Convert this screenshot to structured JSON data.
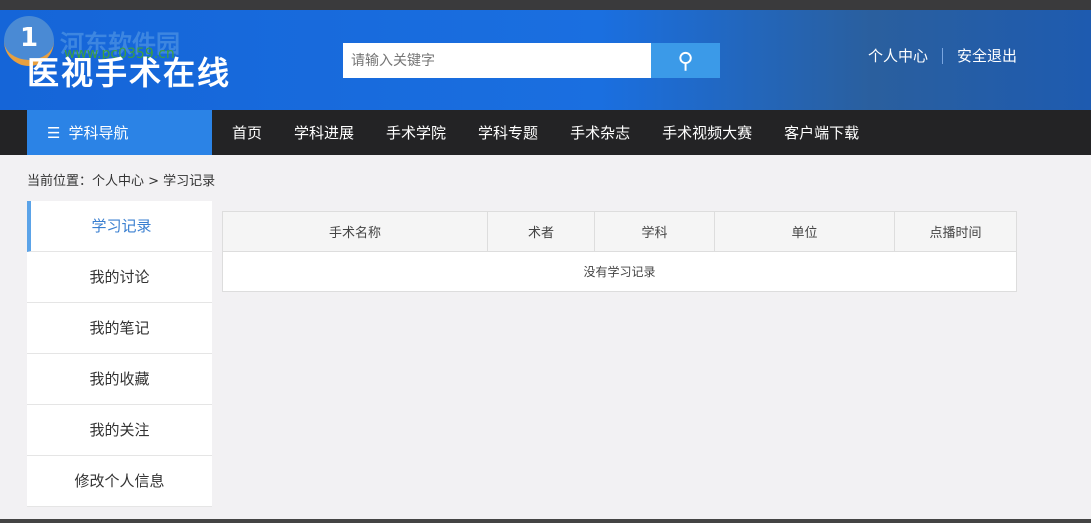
{
  "watermark": {
    "name": "河东软件园",
    "url": "www.pc0359.cn"
  },
  "header": {
    "logo": "医视手术在线",
    "search_placeholder": "请输入关键字",
    "user_center": "个人中心",
    "logout": "安全退出"
  },
  "nav": {
    "category": "学科导航",
    "items": [
      "首页",
      "学科进展",
      "手术学院",
      "学科专题",
      "手术杂志",
      "手术视频大赛",
      "客户端下载"
    ]
  },
  "breadcrumb": "当前位置：个人中心 > 学习记录",
  "sidebar": [
    "学习记录",
    "我的讨论",
    "我的笔记",
    "我的收藏",
    "我的关注",
    "修改个人信息"
  ],
  "table": {
    "headers": [
      "手术名称",
      "术者",
      "学科",
      "单位",
      "点播时间"
    ],
    "empty": "没有学习记录"
  }
}
